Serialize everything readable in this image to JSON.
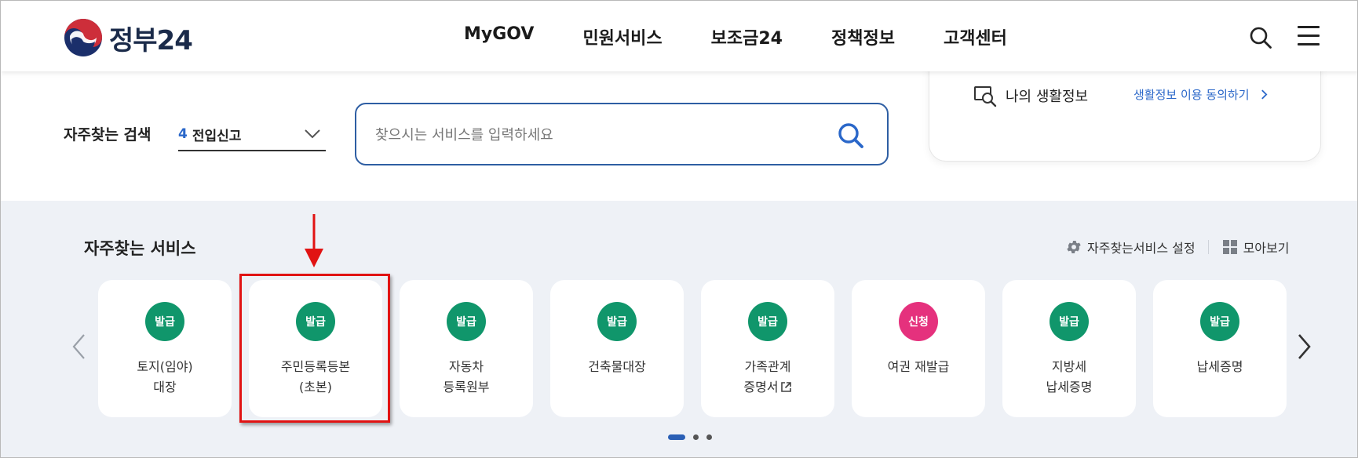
{
  "header": {
    "logo_text": "정부24",
    "nav": [
      "MyGOV",
      "민원서비스",
      "보조금24",
      "정책정보",
      "고객센터"
    ],
    "icons": [
      "search-icon",
      "hamburger-menu-icon"
    ]
  },
  "search": {
    "favorites_label": "자주찾는 검색",
    "selected_rank": "4",
    "selected_keyword": "전입신고",
    "placeholder": "찾으시는 서비스를 입력하세요"
  },
  "life_info": {
    "title": "나의 생활정보",
    "link": "생활정보 이용 동의하기"
  },
  "services": {
    "title": "자주찾는 서비스",
    "settings_label": "자주찾는서비스 설정",
    "view_all_label": "모아보기",
    "items": [
      {
        "badge": "발급",
        "line1": "토지(임야)",
        "line2": "대장",
        "badge_color": "#10966b"
      },
      {
        "badge": "발급",
        "line1": "주민등록등본",
        "line2": "(초본)",
        "badge_color": "#10966b"
      },
      {
        "badge": "발급",
        "line1": "자동차",
        "line2": "등록원부",
        "badge_color": "#10966b"
      },
      {
        "badge": "발급",
        "line1": "건축물대장",
        "line2": "",
        "badge_color": "#10966b"
      },
      {
        "badge": "발급",
        "line1": "가족관계",
        "line2": "증명서",
        "badge_color": "#10966b",
        "external": true
      },
      {
        "badge": "신청",
        "line1": "여권 재발급",
        "line2": "",
        "badge_color": "#e5317d"
      },
      {
        "badge": "발급",
        "line1": "지방세",
        "line2": "납세증명",
        "badge_color": "#10966b"
      },
      {
        "badge": "발급",
        "line1": "납세증명",
        "line2": "",
        "badge_color": "#10966b"
      }
    ],
    "page_count": 3,
    "active_page": 1
  },
  "colors": {
    "accent_blue": "#2a67c9",
    "issue_green": "#10966b",
    "apply_pink": "#e5317d",
    "highlight_red": "#e11313"
  }
}
